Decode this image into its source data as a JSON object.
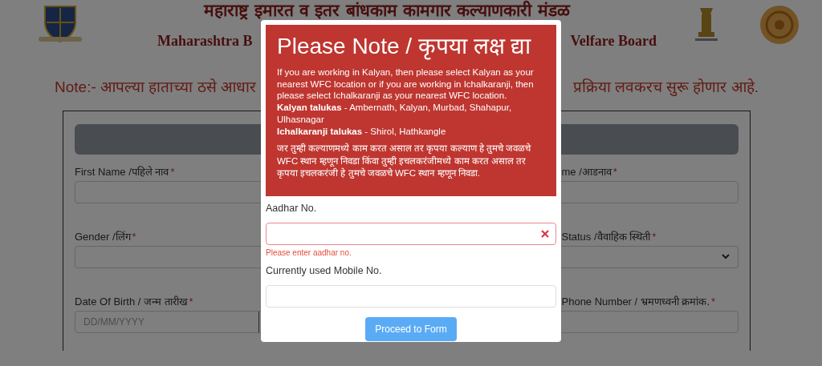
{
  "header": {
    "title": "महाराष्ट्र इमारत व इतर बांधकाम कामगार कल्याणकारी मंडळ",
    "subtitle_left": "Maharashtra B",
    "subtitle_right": "Velfare Board"
  },
  "notice": {
    "left": "Note:- आपल्या हाताच्या ठसे आधार",
    "right": "प्रक्रिया लवकरच सुरू होणार आहे."
  },
  "form": {
    "rows": [
      {
        "left": {
          "label": "First Name /पहिले नाव",
          "mark": "*",
          "kind": "input"
        },
        "right": {
          "label": "me /आडनाव",
          "mark": "*",
          "kind": "input"
        }
      },
      {
        "left": {
          "label": "Gender /लिंग",
          "mark": "*",
          "kind": "input"
        },
        "right": {
          "label": "Status /वैवाहिक स्थिती",
          "mark": "*",
          "kind": "select"
        }
      },
      {
        "left": {
          "label": "Date Of Birth / जन्म तारीख",
          "mark": "*",
          "kind": "date",
          "placeholder": "DD/MM/YYYY"
        },
        "right": {
          "label": "Phone Number / भ्रमणध्वनी क्रमांक.",
          "mark": "*",
          "kind": "input"
        }
      }
    ]
  },
  "modal": {
    "title": "Please Note / कृपया लक्ष द्या",
    "note_lines": [
      "If you are working in Kalyan, then please select Kalyan as your nearest WFC location or if you are working in Ichalkaranji, then please select Ichalkaranji as your nearest WFC location.",
      "**Kalyan talukas** - Ambernath, Kalyan, Murbad, Shahapur, Ulhasnagar",
      "**Ichalkaranji talukas** - Shirol, Hathkangle"
    ],
    "note_marathi": "जर तुम्ही कल्याणमध्ये काम करत असाल तर कृपया कल्याण हे तुमचे जवळचे WFC स्थान म्हणून निवडा किंवा तुम्ही इचलकरंजीमध्ये काम करत असाल तर कृपया इचलकरंजी हे तुमचे जवळचे WFC स्थान म्हणून निवडा.",
    "fields": [
      {
        "label": "Aadhar No.",
        "invalid": true,
        "error": "Please enter aadhar no."
      },
      {
        "label": "Currently used Mobile No.",
        "invalid": false
      }
    ],
    "button": "Proceed to Form"
  }
}
